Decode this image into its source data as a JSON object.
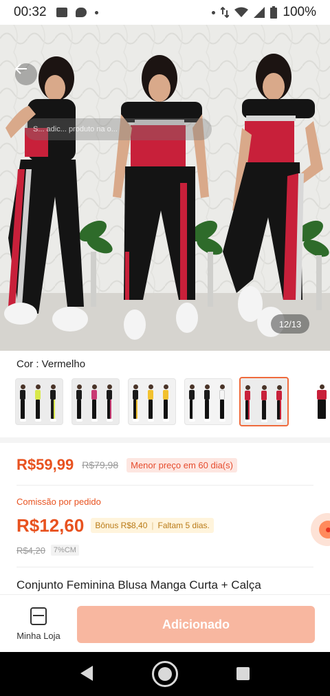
{
  "status_bar": {
    "time": "00:32",
    "battery": "100%",
    "icons": [
      "image-icon",
      "chat-bubble-icon",
      "dot-icon",
      "dot-icon",
      "data-arrows-icon",
      "wifi-icon",
      "signal-icon",
      "battery-icon"
    ]
  },
  "gallery": {
    "image_counter": "12/13",
    "overlay_text": "S... adic... produto na o...",
    "colors": {
      "wall": "#e9e9e6",
      "top_red": "#c8203a",
      "pants_black": "#141414",
      "stripe_red": "#c8203a",
      "sneaker": "#f4f4f4",
      "plant": "#2e6b2a"
    }
  },
  "variant": {
    "label": "Cor : Vermelho",
    "selected_index": 4,
    "options": [
      {
        "name": "Amarelo listra",
        "top": "#1a1a1a",
        "accent": "#d8e84a"
      },
      {
        "name": "Rosa",
        "top": "#1a1a1a",
        "accent": "#c93a73"
      },
      {
        "name": "Amarelo",
        "top": "#1a1a1a",
        "accent": "#f2c12e"
      },
      {
        "name": "Branco",
        "top": "#1a1a1a",
        "accent": "#f5f5f5"
      },
      {
        "name": "Vermelho",
        "top": "#c8203a",
        "accent": "#c8203a"
      },
      {
        "name": "Vermelho 2",
        "top": "#c8203a",
        "accent": "#c8203a"
      }
    ]
  },
  "pricing": {
    "price": "R$59,99",
    "old_price": "R$79,98",
    "lowest_badge": "Menor preço em 60 dia(s)"
  },
  "commission": {
    "label": "Comissão por pedido",
    "value": "R$12,60",
    "bonus": "Bônus R$8,40",
    "days_left": "Faltam 5 dias.",
    "old_value": "R$4,20",
    "rate": "7%CM"
  },
  "product": {
    "title": "Conjunto Feminina Blusa Manga Curta + Calça"
  },
  "bottom_bar": {
    "store_label": "Minha Loja",
    "add_label": "Adicionado"
  },
  "accent_color": "#e8521f"
}
